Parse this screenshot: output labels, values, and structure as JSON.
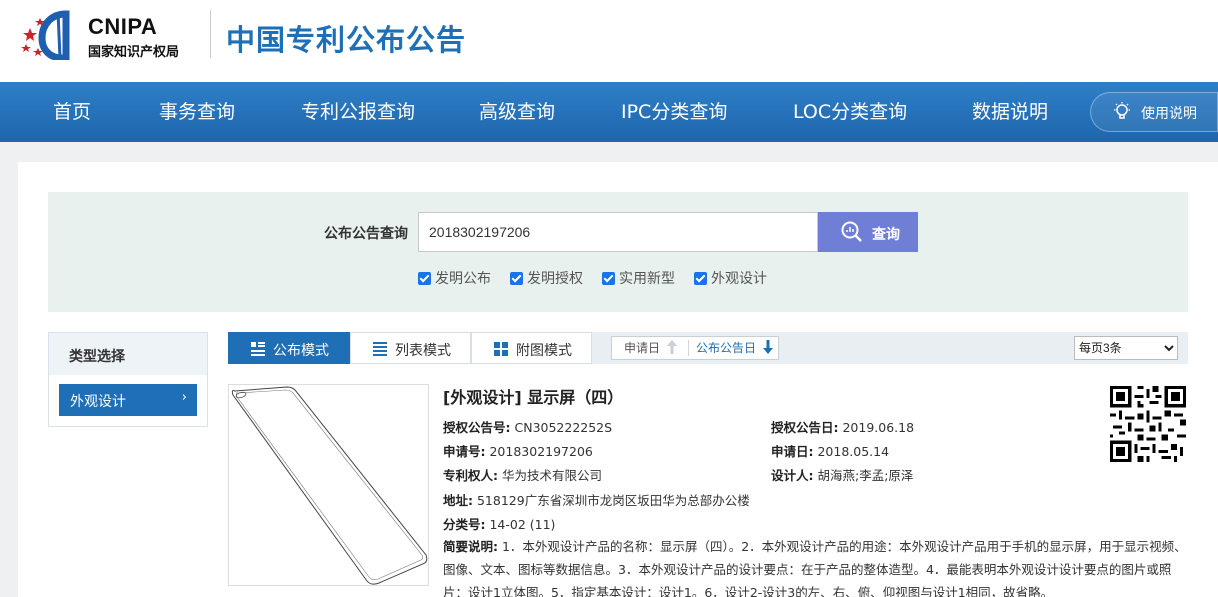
{
  "header": {
    "logo_text": "CNIPA",
    "logo_subtext": "国家知识产权局",
    "site_title": "中国专利公布公告"
  },
  "nav": {
    "items": [
      "首页",
      "事务查询",
      "专利公报查询",
      "高级查询",
      "IPC分类查询",
      "LOC分类查询",
      "数据说明"
    ],
    "help_label": "使用说明"
  },
  "search": {
    "label": "公布公告查询",
    "value": "2018302197206",
    "button_label": "查询",
    "checkboxes": [
      {
        "label": "发明公布",
        "checked": true
      },
      {
        "label": "发明授权",
        "checked": true
      },
      {
        "label": "实用新型",
        "checked": true
      },
      {
        "label": "外观设计",
        "checked": true
      }
    ]
  },
  "sidebar": {
    "title": "类型选择",
    "items": [
      {
        "label": "外观设计",
        "selected": true
      }
    ]
  },
  "toolbar": {
    "modes": [
      "公布模式",
      "列表模式",
      "附图模式"
    ],
    "active_mode": "公布模式",
    "sort": [
      {
        "label": "申请日",
        "direction": "up",
        "active": false
      },
      {
        "label": "公布公告日",
        "direction": "down",
        "active": true
      }
    ],
    "per_page": "每页3条"
  },
  "record": {
    "title": "[外观设计] 显示屏（四）",
    "grant_no_label": "授权公告号:",
    "grant_no": "CN305222252S",
    "grant_date_label": "授权公告日:",
    "grant_date": "2019.06.18",
    "app_no_label": "申请号:",
    "app_no": "2018302197206",
    "app_date_label": "申请日:",
    "app_date": "2018.05.14",
    "patentee_label": "专利权人:",
    "patentee": "华为技术有限公司",
    "designer_label": "设计人:",
    "designer": "胡海燕;李孟;原泽",
    "address_label": "地址:",
    "address": "518129广东省深圳市龙岗区坂田华为总部办公楼",
    "class_label": "分类号:",
    "class_no": "14-02 (11)",
    "abstract_label": "简要说明:",
    "abstract": "1．本外观设计产品的名称：显示屏（四）。2．本外观设计产品的用途：本外观设计产品用于手机的显示屏，用于显示视频、图像、文本、图标等数据信息。3．本外观设计产品的设计要点：在于产品的整体造型。4．最能表明本外观设计设计要点的图片或照片：设计1立体图。5．指定基本设计：设计1。6．设计2-设计3的左、右、俯、仰视图与设计1相同，故省略。"
  },
  "colors": {
    "nav_blue": "#1e6fb5",
    "title_blue": "#1e6fb5",
    "search_button": "#6f7fd6",
    "search_bg": "#e9f1ef"
  }
}
